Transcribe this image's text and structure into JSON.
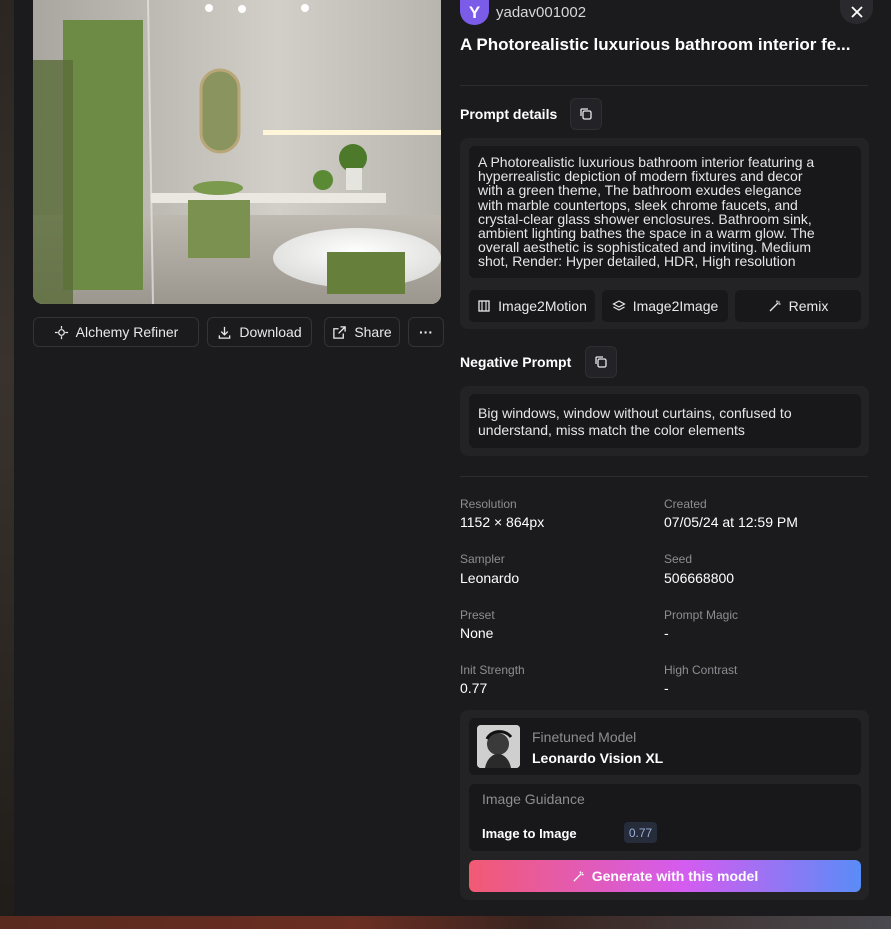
{
  "user": {
    "avatar_letter": "Y",
    "username": "yadav001002"
  },
  "image_title": "A Photorealistic luxurious bathroom interior fe...",
  "actions": {
    "alchemy_refiner": "Alchemy Refiner",
    "download": "Download",
    "share": "Share",
    "more": "···"
  },
  "prompt": {
    "label": "Prompt details",
    "lines": [
      "A Photorealistic luxurious bathroom interior featuring a",
      "hyperrealistic depiction of modern fixtures and decor",
      "with a green theme, The bathroom exudes elegance",
      "with marble countertops, sleek chrome faucets, and",
      "crystal-clear glass shower enclosures. Bathroom sink,",
      "ambient lighting bathes the space in a warm glow. The",
      "overall aesthetic is sophisticated and inviting. Medium",
      "shot, Render: Hyper detailed, HDR, High resolution"
    ]
  },
  "tools": {
    "image2motion": "Image2Motion",
    "image2image": "Image2Image",
    "remix": "Remix"
  },
  "negative_prompt": {
    "label": "Negative Prompt",
    "lines": [
      "Big windows, window without curtains, confused to",
      "understand, miss match the color elements"
    ]
  },
  "meta": {
    "resolution_label": "Resolution",
    "resolution": "1152 × 864px",
    "created_label": "Created",
    "created": "07/05/24 at 12:59 PM",
    "sampler_label": "Sampler",
    "sampler": "Leonardo",
    "seed_label": "Seed",
    "seed": "506668800",
    "preset_label": "Preset",
    "preset": "None",
    "prompt_magic_label": "Prompt Magic",
    "prompt_magic": "-",
    "init_strength_label": "Init Strength",
    "init_strength": "0.77",
    "high_contrast_label": "High Contrast",
    "high_contrast": "-"
  },
  "model": {
    "label": "Finetuned Model",
    "name": "Leonardo Vision XL"
  },
  "guidance": {
    "label": "Image Guidance",
    "type": "Image to Image",
    "value": "0.77"
  },
  "generate_label": "Generate with this model",
  "colors": {
    "accent_start": "#f25a73",
    "accent_mid": "#d45cf0",
    "accent_end": "#5a8cf7",
    "avatar": "#7a5ce8"
  }
}
